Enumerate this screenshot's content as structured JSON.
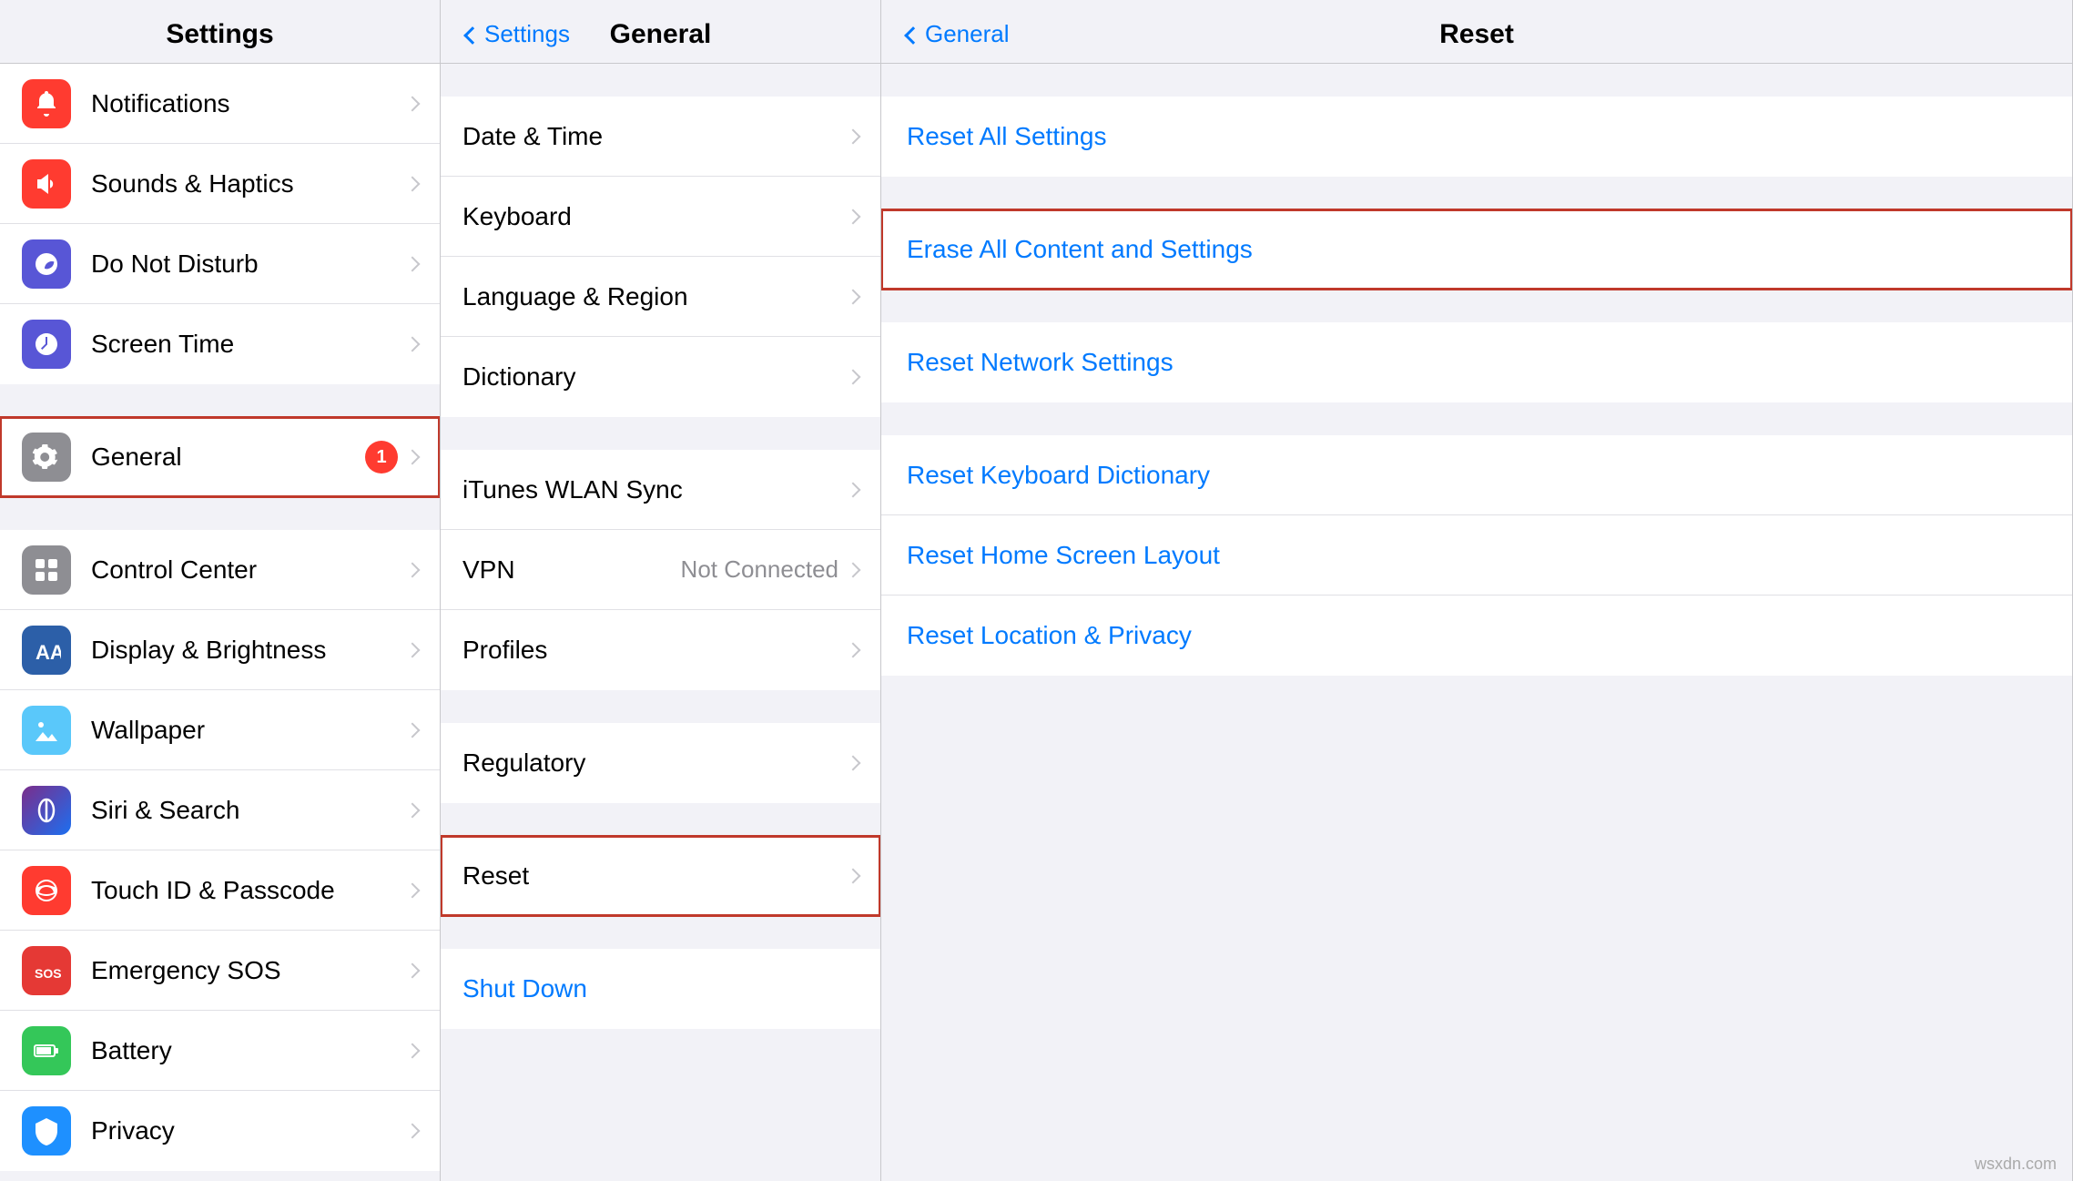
{
  "left_panel": {
    "title": "Settings",
    "items": [
      {
        "id": "notifications",
        "label": "Notifications",
        "icon_color": "#ff3b30",
        "icon_symbol": "bell",
        "badge": null
      },
      {
        "id": "sounds",
        "label": "Sounds & Haptics",
        "icon_color": "#ff3b30",
        "icon_symbol": "speaker",
        "badge": null
      },
      {
        "id": "do-not-disturb",
        "label": "Do Not Disturb",
        "icon_color": "#5856d6",
        "icon_symbol": "moon",
        "badge": null
      },
      {
        "id": "screen-time",
        "label": "Screen Time",
        "icon_color": "#5856d6",
        "icon_symbol": "hourglass",
        "badge": null
      },
      {
        "id": "general",
        "label": "General",
        "icon_color": "#8e8e93",
        "icon_symbol": "gear",
        "badge": "1",
        "highlighted": true
      },
      {
        "id": "control-center",
        "label": "Control Center",
        "icon_color": "#8e8e93",
        "icon_symbol": "sliders",
        "badge": null
      },
      {
        "id": "display",
        "label": "Display & Brightness",
        "icon_color": "#2c5fa8",
        "icon_symbol": "aa",
        "badge": null
      },
      {
        "id": "wallpaper",
        "label": "Wallpaper",
        "icon_color": "#5ac8fa",
        "icon_symbol": "flower",
        "badge": null
      },
      {
        "id": "siri",
        "label": "Siri & Search",
        "icon_color": "siri",
        "icon_symbol": "siri",
        "badge": null
      },
      {
        "id": "touch-id",
        "label": "Touch ID & Passcode",
        "icon_color": "#ff3b30",
        "icon_symbol": "fingerprint",
        "badge": null
      },
      {
        "id": "emergency-sos",
        "label": "Emergency SOS",
        "icon_color": "#e53935",
        "icon_symbol": "sos",
        "badge": null
      },
      {
        "id": "battery",
        "label": "Battery",
        "icon_color": "#34c759",
        "icon_symbol": "battery",
        "badge": null
      },
      {
        "id": "privacy",
        "label": "Privacy",
        "icon_color": "#1e90ff",
        "icon_symbol": "hand",
        "badge": null
      }
    ]
  },
  "middle_panel": {
    "back_label": "Settings",
    "title": "General",
    "groups": [
      {
        "items": [
          {
            "id": "date-time",
            "label": "Date & Time",
            "value": null
          },
          {
            "id": "keyboard",
            "label": "Keyboard",
            "value": null
          },
          {
            "id": "language-region",
            "label": "Language & Region",
            "value": null
          },
          {
            "id": "dictionary",
            "label": "Dictionary",
            "value": null
          }
        ]
      },
      {
        "items": [
          {
            "id": "itunes-wlan",
            "label": "iTunes WLAN Sync",
            "value": null
          },
          {
            "id": "vpn",
            "label": "VPN",
            "value": "Not Connected"
          },
          {
            "id": "profiles",
            "label": "Profiles",
            "value": null
          }
        ]
      },
      {
        "items": [
          {
            "id": "regulatory",
            "label": "Regulatory",
            "value": null
          }
        ]
      },
      {
        "items": [
          {
            "id": "reset",
            "label": "Reset",
            "value": null,
            "highlighted": true
          }
        ]
      },
      {
        "items": [
          {
            "id": "shut-down",
            "label": "Shut Down",
            "value": null,
            "is_blue": true
          }
        ]
      }
    ]
  },
  "right_panel": {
    "back_label": "General",
    "title": "Reset",
    "groups": [
      {
        "items": [
          {
            "id": "reset-all-settings",
            "label": "Reset All Settings"
          }
        ]
      },
      {
        "items": [
          {
            "id": "erase-all-content",
            "label": "Erase All Content and Settings",
            "highlighted": true
          }
        ]
      },
      {
        "items": [
          {
            "id": "reset-network",
            "label": "Reset Network Settings"
          }
        ]
      },
      {
        "items": [
          {
            "id": "reset-keyboard",
            "label": "Reset Keyboard Dictionary"
          },
          {
            "id": "reset-home-screen",
            "label": "Reset Home Screen Layout"
          },
          {
            "id": "reset-location",
            "label": "Reset Location & Privacy"
          }
        ]
      }
    ]
  }
}
